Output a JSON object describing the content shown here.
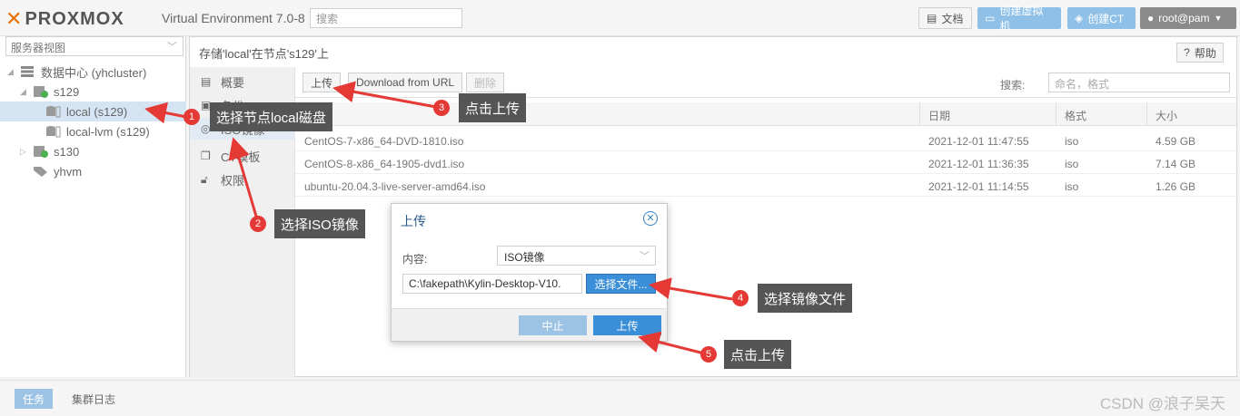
{
  "header": {
    "logo_text": "PROXMOX",
    "app_version": "Virtual Environment 7.0-8",
    "search_placeholder": "搜索",
    "docs_label": "文档",
    "create_vm_label": "创建虚拟机",
    "create_ct_label": "创建CT",
    "user_label": "root@pam"
  },
  "sidebar": {
    "view_label": "服务器视图",
    "tree": [
      {
        "label": "数据中心 (yhcluster)",
        "icon": "datacenter-icon"
      },
      {
        "label": "s129",
        "icon": "node-online-icon"
      },
      {
        "label": "local (s129)",
        "icon": "storage-icon"
      },
      {
        "label": "local-lvm (s129)",
        "icon": "storage-icon"
      },
      {
        "label": "s130",
        "icon": "node-online-icon"
      },
      {
        "label": "yhvm",
        "icon": "tag-icon"
      }
    ]
  },
  "main": {
    "title": "存储'local'在节点's129'上",
    "help_label": "帮助",
    "nav": [
      {
        "label": "概要",
        "icon": "book-icon"
      },
      {
        "label": "备份",
        "icon": "floppy-icon"
      },
      {
        "label": "ISO镜像",
        "icon": "disc-icon"
      },
      {
        "label": "CT模板",
        "icon": "template-icon"
      },
      {
        "label": "权限",
        "icon": "unlock-icon"
      }
    ],
    "toolbar": {
      "upload_label": "上传",
      "download_label": "Download from URL",
      "delete_label": "删除",
      "search_label": "搜索:",
      "search_placeholder": "命名，格式"
    },
    "columns": {
      "name": "",
      "date": "日期",
      "format": "格式",
      "size": "大小"
    },
    "rows": [
      {
        "name": "CentOS-7-x86_64-DVD-1810.iso",
        "date": "2021-12-01 11:47:55",
        "format": "iso",
        "size": "4.59 GB"
      },
      {
        "name": "CentOS-8-x86_64-1905-dvd1.iso",
        "date": "2021-12-01 11:36:35",
        "format": "iso",
        "size": "7.14 GB"
      },
      {
        "name": "ubuntu-20.04.3-live-server-amd64.iso",
        "date": "2021-12-01 11:14:55",
        "format": "iso",
        "size": "1.26 GB"
      }
    ]
  },
  "dialog": {
    "title": "上传",
    "content_label": "内容:",
    "content_value": "ISO镜像",
    "file_path": "C:\\fakepath\\Kylin-Desktop-V10.",
    "choose_file_label": "选择文件...",
    "abort_label": "中止",
    "upload_label": "上传"
  },
  "footer": {
    "tasks_label": "任务",
    "cluster_log_label": "集群日志",
    "watermark": "CSDN @浪子吴天"
  },
  "annotations": [
    {
      "num": "1",
      "text": "选择节点local磁盘"
    },
    {
      "num": "2",
      "text": "选择ISO镜像"
    },
    {
      "num": "3",
      "text": "点击上传"
    },
    {
      "num": "4",
      "text": "选择镜像文件"
    },
    {
      "num": "5",
      "text": "点击上传"
    }
  ],
  "colors": {
    "accent": "#3b8fd9",
    "annotation": "#e53935",
    "callout_bg": "#555555"
  }
}
